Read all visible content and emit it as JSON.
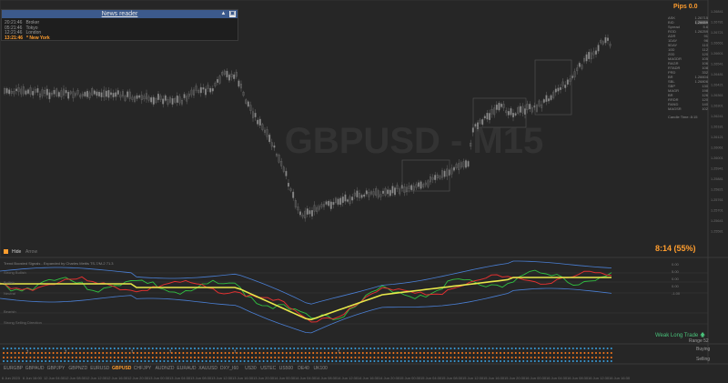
{
  "window": {
    "tab_label": "GBPUSD,M15"
  },
  "chart": {
    "watermark": "GBPUSD - M15"
  },
  "news_reader": {
    "title": "News reader",
    "rows": [
      {
        "time": "20:21:46",
        "name": "Broker"
      },
      {
        "time": "05:21:46",
        "name": "Tokyo"
      },
      {
        "time": "12:21:46",
        "name": "London"
      },
      {
        "time": "13:21:46",
        "name": "* New York",
        "active": true
      }
    ]
  },
  "panel": {
    "pips": "Pips 0.0",
    "rows": [
      {
        "label": "ASK",
        "value": "1.26715"
      },
      {
        "label": "BID",
        "value": "1.26659",
        "hl": true
      },
      {
        "label": "Spread",
        "value": "5.6"
      },
      {
        "label": "ROD",
        "value": "1.26259"
      },
      {
        "label": "ADR",
        "value": "91"
      },
      {
        "label": "1DAY",
        "value": "96"
      },
      {
        "label": "5DAY",
        "value": "110"
      },
      {
        "label": "10D",
        "value": "112"
      },
      {
        "label": "20D",
        "value": "120"
      },
      {
        "label": "MAGDR",
        "value": "105"
      },
      {
        "label": "RAGR",
        "value": "106"
      },
      {
        "label": "RTADR",
        "value": "108"
      },
      {
        "label": "PRD",
        "value": "332"
      },
      {
        "label": "BR",
        "value": "1.26604"
      },
      {
        "label": "SBL",
        "value": "1.26806"
      },
      {
        "label": "SBP",
        "value": "130"
      },
      {
        "label": "MAGR",
        "value": "198"
      },
      {
        "label": "BR",
        "value": "126"
      },
      {
        "label": "RRDR",
        "value": "120"
      },
      {
        "label": "RAND",
        "value": "140"
      },
      {
        "label": "MAGSR",
        "value": "102"
      }
    ],
    "candle_time": "Candle Time: 8:15",
    "countdown": "8:14 (55%)"
  },
  "price_axis": [
    "1.26841",
    "1.26781",
    "1.26721",
    "1.26661",
    "1.26601",
    "1.26541",
    "1.26481",
    "1.26421",
    "1.26361",
    "1.26301",
    "1.26241",
    "1.26181",
    "1.26121",
    "1.26061",
    "1.26001",
    "1.25941",
    "1.25881",
    "1.25821",
    "1.25761",
    "1.25701",
    "1.25641",
    "1.25581",
    "1.25521"
  ],
  "hide_bar": {
    "hide": "Hide",
    "arrow": "Arrow"
  },
  "indicator": {
    "title": "Trend Boosted Signals - Expanded by Charles Mettis TS-7/M-2 71.3",
    "bands": [
      "Strong Bullish",
      "Bullish",
      "Neutral",
      "Bearish",
      "Strong Selling Direction"
    ],
    "scale": [
      "0.00",
      "5.00",
      "0.00",
      "0.00",
      "-1.00"
    ],
    "weak_long": "Weak Long Trade",
    "range": "Range 52",
    "buying": "Buying",
    "selling": "Selling"
  },
  "symbols": [
    "EURGBP",
    "GBPAUD",
    "GBPJPY",
    "GBPNZD",
    "EURUSD",
    "GBPUSD",
    "CHFJPY",
    "AUDNZD",
    "EURAUD",
    "XAUUSD",
    "DXY_I60",
    "US30",
    "USTEC",
    "US500",
    "DE40",
    "UK100"
  ],
  "active_symbol": "GBPUSD",
  "time_axis": [
    "6 Jun 2023",
    "6 Jun 16:00",
    "12 Jun 04:30",
    "12 Jun 08:30",
    "12 Jun 12:30",
    "12 Jun 16:30",
    "12 Jun 20:30",
    "13 Jun 00:30",
    "13 Jun 04:30",
    "13 Jun 08:30",
    "13 Jun 12:30",
    "13 Jun 16:30",
    "13 Jun 20:30",
    "14 Jun 00:30",
    "14 Jun 04:30",
    "14 Jun 08:30",
    "14 Jun 12:30",
    "14 Jun 16:30",
    "14 Jun 20:30",
    "15 Jun 00:30",
    "15 Jun 04:30",
    "15 Jun 08:30",
    "15 Jun 12:30",
    "15 Jun 16:30",
    "15 Jun 20:30",
    "16 Jun 00:30",
    "16 Jun 04:30",
    "16 Jun 08:30",
    "16 Jun 12:30",
    "16 Jun 16:30"
  ],
  "colors": {
    "background": "#262626",
    "accent_orange": "#ff9d2e",
    "news_bar": "#3c5a8c",
    "ma_yellow": "#e8e84a",
    "line_red": "#e03030",
    "line_green": "#30c040",
    "band_blue": "#4a7fd4",
    "dot_blue": "#3aa0e0",
    "dot_orange": "#ff7a1a",
    "trade_green": "#49c27a"
  }
}
